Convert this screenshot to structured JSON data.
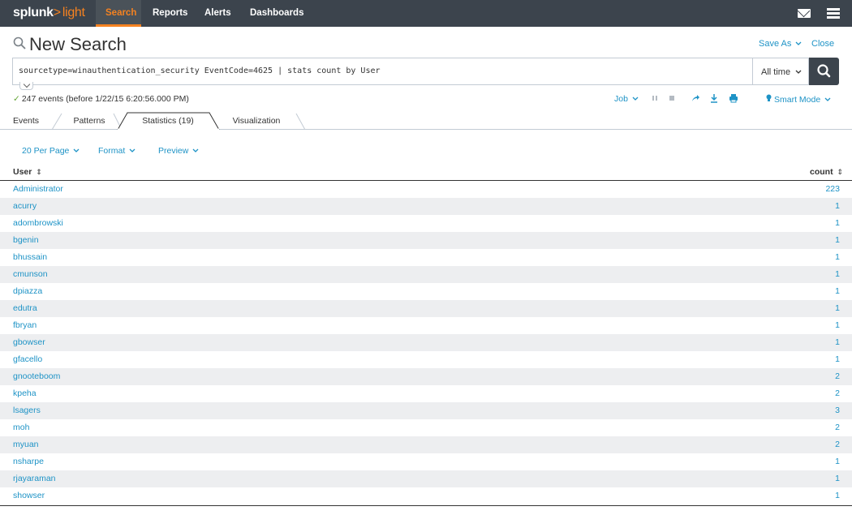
{
  "nav": {
    "brand": "splunk",
    "brand_suffix": ">",
    "brand_product": "light",
    "items": [
      {
        "label": "Search"
      },
      {
        "label": "Reports"
      },
      {
        "label": "Alerts"
      },
      {
        "label": "Dashboards"
      }
    ],
    "icons": [
      "mail-icon",
      "menu-icon"
    ]
  },
  "header": {
    "title": "New Search",
    "save_as": "Save As",
    "close": "Close"
  },
  "search": {
    "query": "sourcetype=winauthentication_security EventCode=4625 | stats count by User",
    "time_range": "All time"
  },
  "status": {
    "events_text": "247 events (before 1/22/15 6:20:56.000 PM)",
    "job_label": "Job",
    "smart_mode": "Smart Mode"
  },
  "tabs": [
    {
      "label": "Events"
    },
    {
      "label": "Patterns"
    },
    {
      "label": "Statistics (19)",
      "active": true
    },
    {
      "label": "Visualization"
    }
  ],
  "table_controls": {
    "per_page": "20 Per Page",
    "format": "Format",
    "preview": "Preview"
  },
  "table": {
    "columns": [
      "User",
      "count"
    ],
    "rows": [
      {
        "user": "Administrator",
        "count": "223"
      },
      {
        "user": "acurry",
        "count": "1"
      },
      {
        "user": "adombrowski",
        "count": "1"
      },
      {
        "user": "bgenin",
        "count": "1"
      },
      {
        "user": "bhussain",
        "count": "1"
      },
      {
        "user": "cmunson",
        "count": "1"
      },
      {
        "user": "dpiazza",
        "count": "1"
      },
      {
        "user": "edutra",
        "count": "1"
      },
      {
        "user": "fbryan",
        "count": "1"
      },
      {
        "user": "gbowser",
        "count": "1"
      },
      {
        "user": "gfacello",
        "count": "1"
      },
      {
        "user": "gnooteboom",
        "count": "2"
      },
      {
        "user": "kpeha",
        "count": "2"
      },
      {
        "user": "lsagers",
        "count": "3"
      },
      {
        "user": "moh",
        "count": "2"
      },
      {
        "user": "myuan",
        "count": "2"
      },
      {
        "user": "nsharpe",
        "count": "1"
      },
      {
        "user": "rjayaraman",
        "count": "1"
      },
      {
        "user": "showser",
        "count": "1"
      }
    ]
  },
  "colors": {
    "nav_bg": "#3c444d",
    "accent": "#f58220",
    "link": "#1e93c6",
    "row_stripe": "#edeef0",
    "check": "#65a637"
  }
}
